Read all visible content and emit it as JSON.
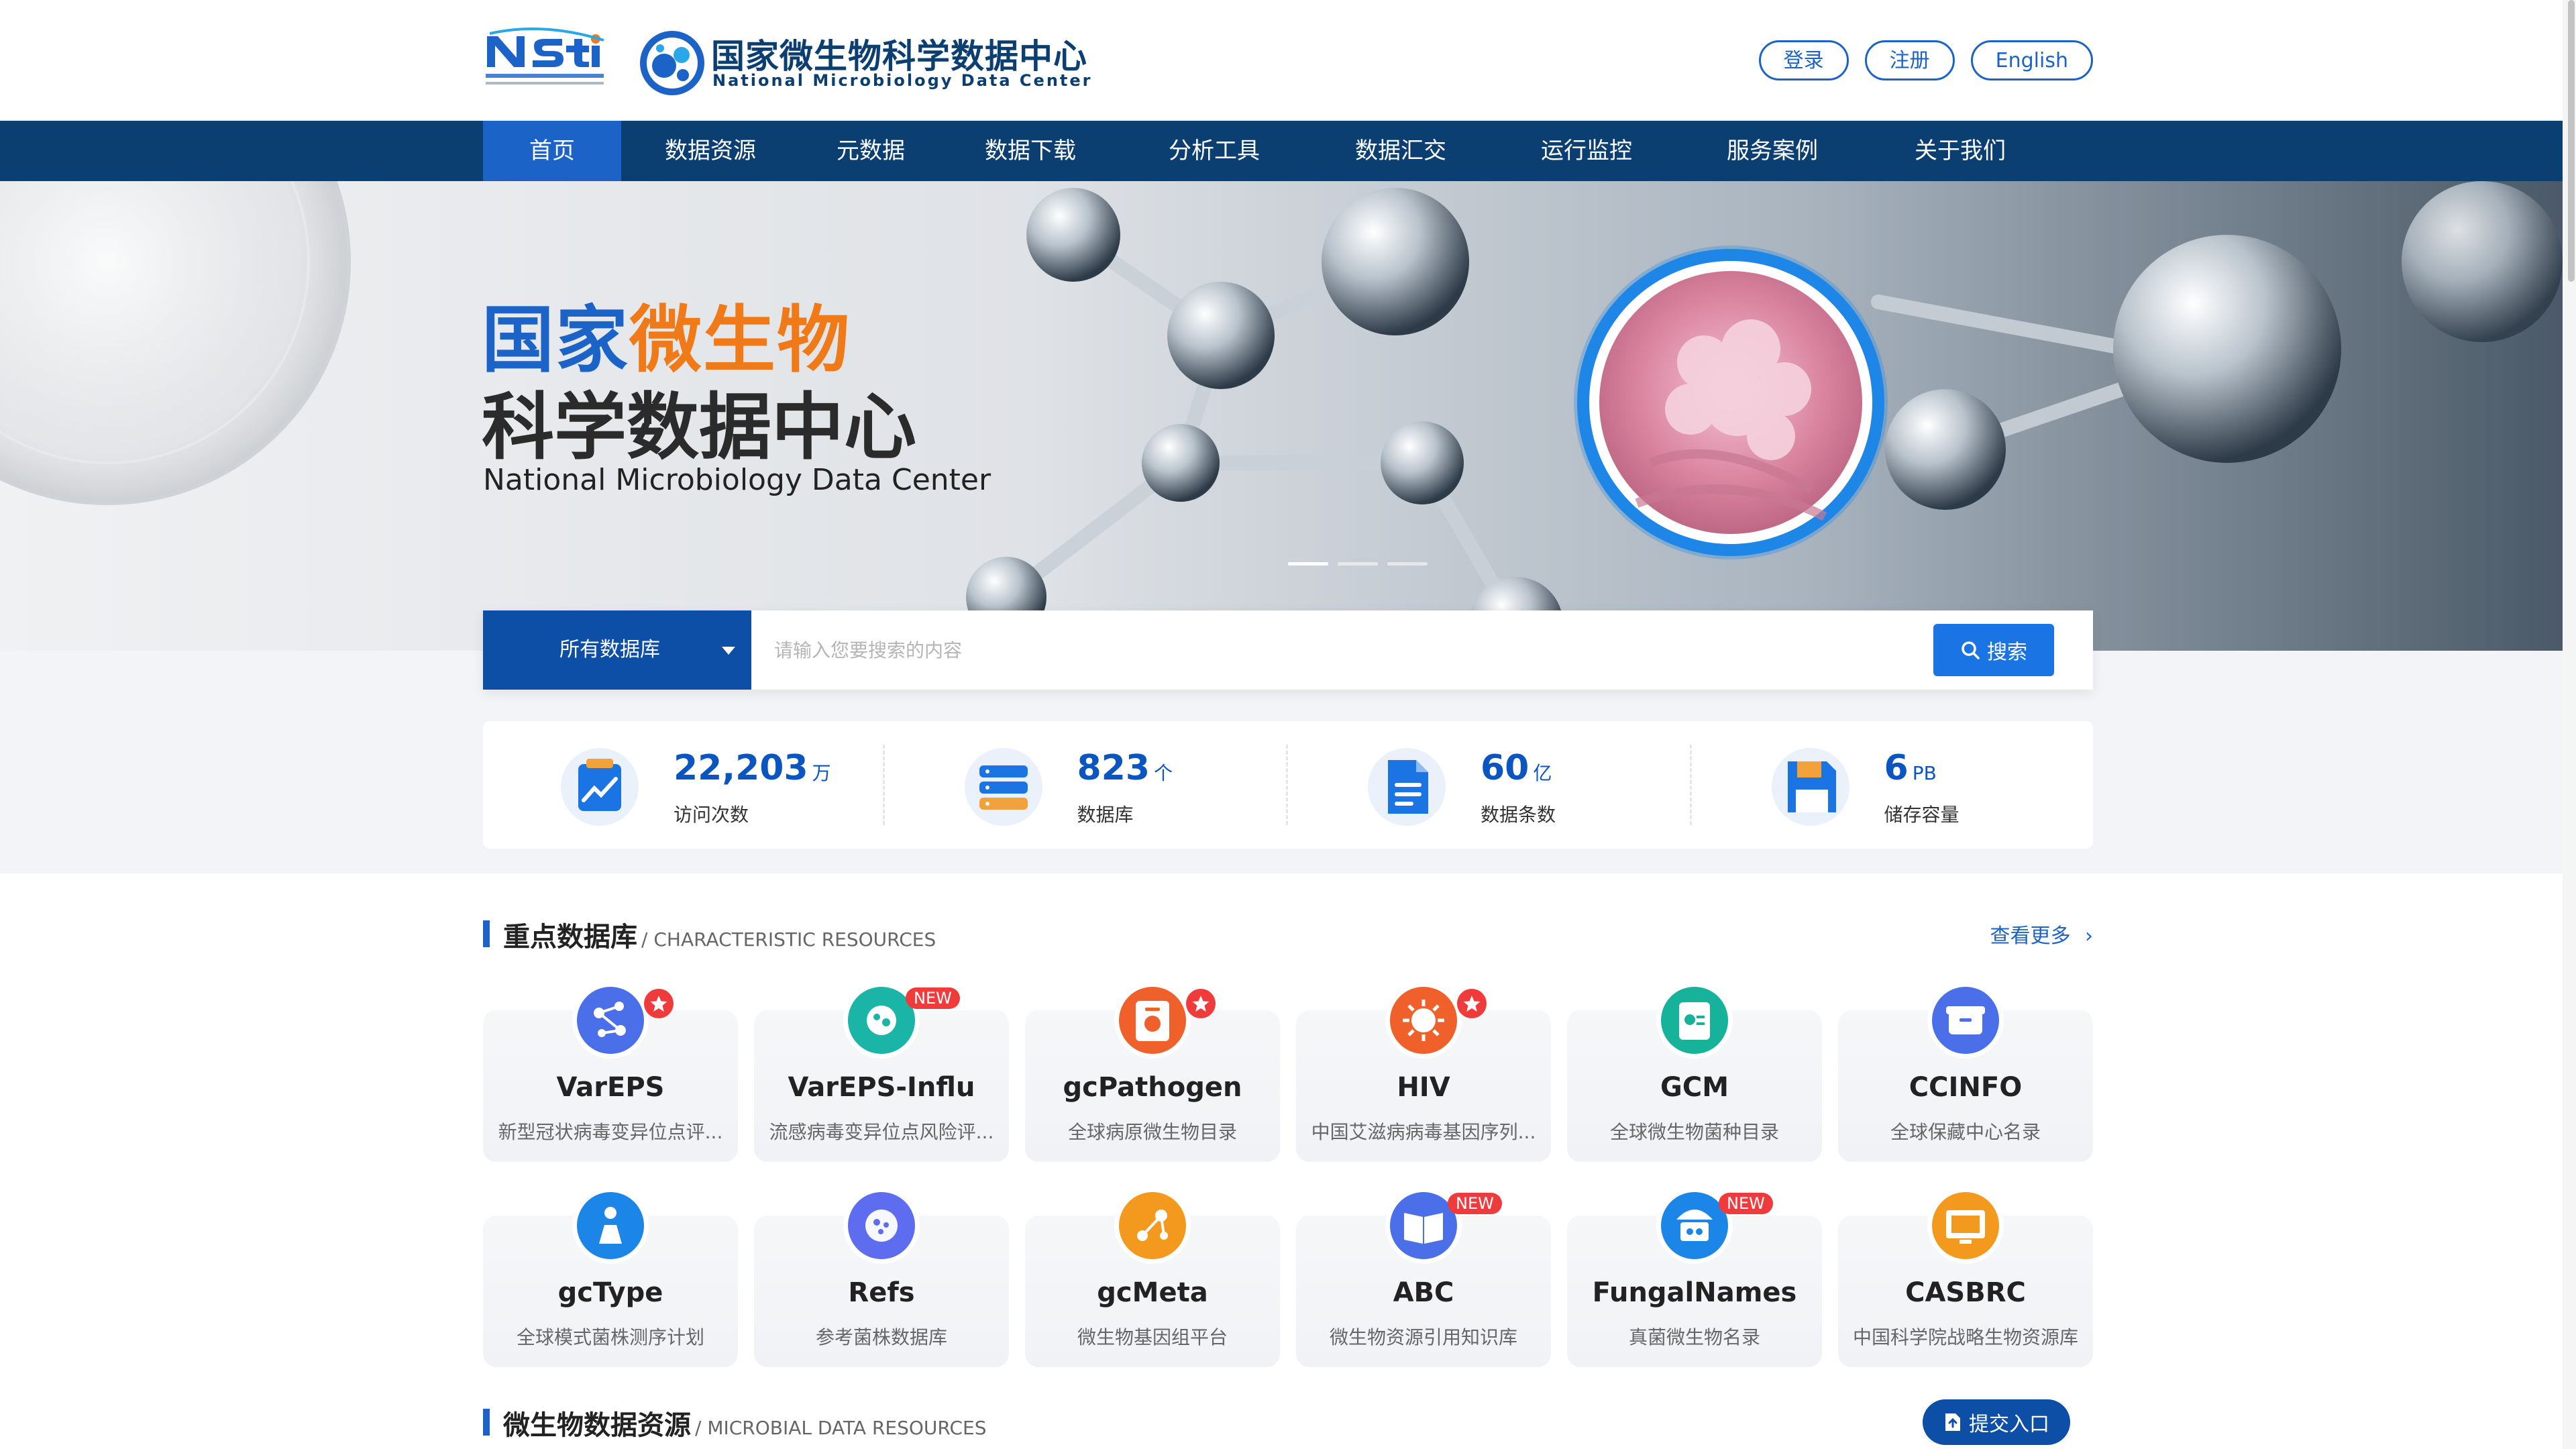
{
  "header": {
    "logo_nsti": "Nsti",
    "logo_title": "国家微生物科学数据中心",
    "logo_subtitle": "National Microbiology Data Center",
    "login": "登录",
    "register": "注册",
    "english": "English"
  },
  "nav": {
    "items": [
      "首页",
      "数据资源",
      "元数据",
      "数据下载",
      "分析工具",
      "数据汇交",
      "运行监控",
      "服务案例",
      "关于我们"
    ],
    "active_index": 0
  },
  "hero": {
    "title_a": "国家",
    "title_b": "微生物",
    "title_line2": "科学数据中心",
    "subtitle": "National  Microbiology Data Center"
  },
  "search": {
    "select_value": "所有数据库",
    "placeholder": "请输入您要搜索的内容",
    "button": "搜索"
  },
  "stats": [
    {
      "value": "22,203",
      "unit": "万",
      "label": "访问次数"
    },
    {
      "value": "823",
      "unit": "个",
      "label": "数据库"
    },
    {
      "value": "60",
      "unit": "亿",
      "label": "数据条数"
    },
    {
      "value": "6",
      "unit": "PB",
      "label": "储存容量"
    }
  ],
  "sections": {
    "featured_title": "重点数据库",
    "featured_title_en": "/ CHARACTERISTIC RESOURCES",
    "featured_more": "查看更多",
    "microbial_title": "微生物数据资源",
    "microbial_title_en": "/ MICROBIAL DATA RESOURCES",
    "submit_button": "提交入口"
  },
  "badges": {
    "new": "NEW"
  },
  "cards": [
    {
      "title": "VarEPS",
      "desc": "新型冠状病毒变异位点评...",
      "color": "#4a6fe8",
      "badge": "star"
    },
    {
      "title": "VarEPS-Influ",
      "desc": "流感病毒变异位点风险评...",
      "color": "#1bb5a8",
      "badge": "new"
    },
    {
      "title": "gcPathogen",
      "desc": "全球病原微生物目录",
      "color": "#f0602b",
      "badge": "star"
    },
    {
      "title": "HIV",
      "desc": "中国艾滋病病毒基因序列...",
      "color": "#f0602b",
      "badge": "star"
    },
    {
      "title": "GCM",
      "desc": "全球微生物菌种目录",
      "color": "#17b29a",
      "badge": ""
    },
    {
      "title": "CCINFO",
      "desc": "全球保藏中心名录",
      "color": "#4a6fe8",
      "badge": ""
    },
    {
      "title": "gcType",
      "desc": "全球模式菌株测序计划",
      "color": "#1b86e8",
      "badge": ""
    },
    {
      "title": "Refs",
      "desc": "参考菌株数据库",
      "color": "#5e6df0",
      "badge": ""
    },
    {
      "title": "gcMeta",
      "desc": "微生物基因组平台",
      "color": "#f39a1e",
      "badge": ""
    },
    {
      "title": "ABC",
      "desc": "微生物资源引用知识库",
      "color": "#4a6fe8",
      "badge": "new"
    },
    {
      "title": "FungalNames",
      "desc": "真菌微生物名录",
      "color": "#1b86e8",
      "badge": "new"
    },
    {
      "title": "CASBRC",
      "desc": "中国科学院战略生物资源库",
      "color": "#f39a1e",
      "badge": ""
    }
  ]
}
